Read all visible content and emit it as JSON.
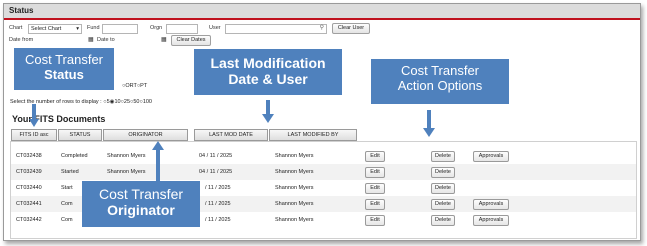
{
  "header": {
    "title": "Status"
  },
  "filters": {
    "chart_label": "Chart",
    "chart_value": "Select Chart",
    "fund_label": "Fund",
    "orgn_label": "Orgn",
    "user_label": "User",
    "clear_user": "Clear User",
    "date_from_label": "Date from",
    "date_to_label": "Date to",
    "clear_dates": "Clear Dates",
    "status_suffix": "ORT",
    "pt_label": "PT",
    "rows_label": "Select the number of rows to display :",
    "rows_options": [
      "5",
      "10",
      "25",
      "50",
      "100"
    ]
  },
  "documents": {
    "title": "Your FITS Documents",
    "columns": [
      "FITS ID asc",
      "STATUS",
      "ORIGINATOR",
      "LAST MOD DATE",
      "LAST MODIFIED BY"
    ],
    "rows": [
      {
        "id": "CT032438",
        "status": "Completed",
        "originator": "Shannon Myers",
        "date": "04 / 11 / 2025",
        "modified_by": "Shannon Myers",
        "approvals": true
      },
      {
        "id": "CT032439",
        "status": "Started",
        "originator": "Shannon Myers",
        "date": "04 / 11 / 2025",
        "modified_by": "Shannon Myers",
        "approvals": false
      },
      {
        "id": "CT032440",
        "status": "Start",
        "originator": "",
        "date": "/ 11 / 2025",
        "modified_by": "Shannon Myers",
        "approvals": false
      },
      {
        "id": "CT032441",
        "status": "Com",
        "originator": "",
        "date": "/ 11 / 2025",
        "modified_by": "Shannon Myers",
        "approvals": true
      },
      {
        "id": "CT032442",
        "status": "Com",
        "originator": "",
        "date": "/ 11 / 2025",
        "modified_by": "Shannon Myers",
        "approvals": true
      }
    ],
    "edit_label": "Edit",
    "delete_label": "Delete",
    "approvals_label": "Approvals"
  },
  "callouts": {
    "status": {
      "line1": "Cost Transfer",
      "line2": "Status"
    },
    "last_mod": {
      "line1": "Last Modification",
      "line2": "Date & User"
    },
    "actions": {
      "line1": "Cost Transfer",
      "line2": "Action Options"
    },
    "originator": {
      "line1": "Cost Transfer",
      "line2": "Originator"
    }
  },
  "colors": {
    "callout_bg": "#4f81bd",
    "header_rule": "#c0121f",
    "arrow": "#4f81bd"
  }
}
